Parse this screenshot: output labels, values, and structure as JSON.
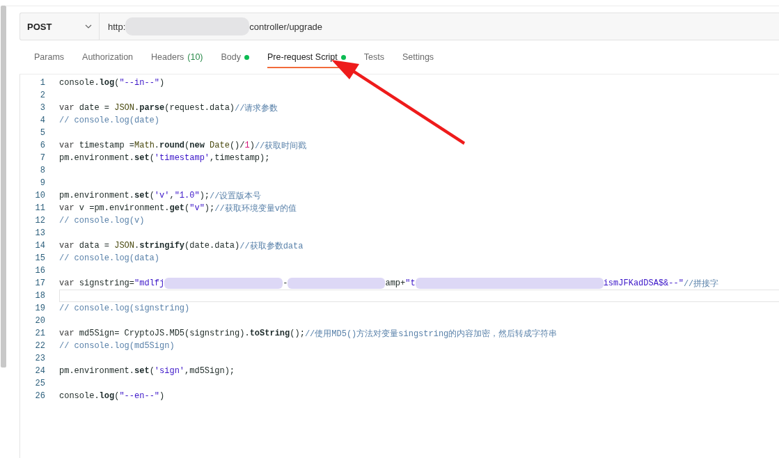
{
  "request": {
    "method": "POST",
    "url_start": "http:",
    "url_end": "controller/upgrade"
  },
  "tabs": [
    {
      "label": "Params",
      "selected": false,
      "dot": false
    },
    {
      "label": "Authorization",
      "selected": false,
      "dot": false
    },
    {
      "label": "Headers",
      "count": "(10)",
      "selected": false,
      "dot": false
    },
    {
      "label": "Body",
      "selected": false,
      "dot": true
    },
    {
      "label": "Pre-request Script",
      "selected": true,
      "dot": true
    },
    {
      "label": "Tests",
      "selected": false,
      "dot": false
    },
    {
      "label": "Settings",
      "selected": false,
      "dot": false
    }
  ],
  "editor": {
    "lines": [
      {
        "number": "1",
        "tokens": [
          {
            "kind": "plain",
            "text": "console."
          },
          {
            "kind": "fn",
            "text": "log"
          },
          {
            "kind": "plain",
            "text": "("
          },
          {
            "kind": "str",
            "text": "\"--in--\""
          },
          {
            "kind": "plain",
            "text": ")"
          }
        ]
      },
      {
        "number": "2"
      },
      {
        "number": "3",
        "tokens": [
          {
            "kind": "kw",
            "text": "var"
          },
          {
            "kind": "plain",
            "text": " date = "
          },
          {
            "kind": "obj",
            "text": "JSON"
          },
          {
            "kind": "plain",
            "text": "."
          },
          {
            "kind": "fn",
            "text": "parse"
          },
          {
            "kind": "plain",
            "text": "(request.data)"
          },
          {
            "kind": "cmt",
            "text": "//请求参数"
          }
        ]
      },
      {
        "number": "4",
        "tokens": [
          {
            "kind": "cmt",
            "text": "// console.log(date)"
          }
        ]
      },
      {
        "number": "5"
      },
      {
        "number": "6",
        "tokens": [
          {
            "kind": "kw",
            "text": "var"
          },
          {
            "kind": "plain",
            "text": " timestamp ="
          },
          {
            "kind": "obj",
            "text": "Math"
          },
          {
            "kind": "plain",
            "text": "."
          },
          {
            "kind": "fn",
            "text": "round"
          },
          {
            "kind": "plain",
            "text": "("
          },
          {
            "kind": "fn",
            "text": "new"
          },
          {
            "kind": "obj",
            "text": " Date"
          },
          {
            "kind": "plain",
            "text": "()/"
          },
          {
            "kind": "num",
            "text": "1"
          },
          {
            "kind": "plain",
            "text": ")"
          },
          {
            "kind": "cmt",
            "text": "//获取时间戳"
          }
        ]
      },
      {
        "number": "7",
        "tokens": [
          {
            "kind": "plain",
            "text": "pm.environment."
          },
          {
            "kind": "fn",
            "text": "set"
          },
          {
            "kind": "plain",
            "text": "("
          },
          {
            "kind": "str",
            "text": "'timestamp'"
          },
          {
            "kind": "plain",
            "text": ",timestamp);"
          }
        ]
      },
      {
        "number": "8"
      },
      {
        "number": "9"
      },
      {
        "number": "10",
        "tokens": [
          {
            "kind": "plain",
            "text": "pm.environment."
          },
          {
            "kind": "fn",
            "text": "set"
          },
          {
            "kind": "plain",
            "text": "("
          },
          {
            "kind": "str",
            "text": "'v'"
          },
          {
            "kind": "plain",
            "text": ","
          },
          {
            "kind": "str",
            "text": "\"1.0\""
          },
          {
            "kind": "plain",
            "text": ");"
          },
          {
            "kind": "cmt",
            "text": "//设置版本号"
          }
        ]
      },
      {
        "number": "11",
        "tokens": [
          {
            "kind": "kw",
            "text": "var"
          },
          {
            "kind": "plain",
            "text": " v =pm.environment."
          },
          {
            "kind": "fn",
            "text": "get"
          },
          {
            "kind": "plain",
            "text": "("
          },
          {
            "kind": "str",
            "text": "\"v\""
          },
          {
            "kind": "plain",
            "text": ");"
          },
          {
            "kind": "cmt",
            "text": "//获取环境变量v的值"
          }
        ]
      },
      {
        "number": "12",
        "tokens": [
          {
            "kind": "cmt",
            "text": "// console.log(v)"
          }
        ]
      },
      {
        "number": "13"
      },
      {
        "number": "14",
        "tokens": [
          {
            "kind": "kw",
            "text": "var"
          },
          {
            "kind": "plain",
            "text": " data = "
          },
          {
            "kind": "obj",
            "text": "JSON"
          },
          {
            "kind": "plain",
            "text": "."
          },
          {
            "kind": "fn",
            "text": "stringify"
          },
          {
            "kind": "plain",
            "text": "(date.data)"
          },
          {
            "kind": "cmt",
            "text": "//获取参数data"
          }
        ]
      },
      {
        "number": "15",
        "tokens": [
          {
            "kind": "cmt",
            "text": "// console.log(data)"
          }
        ]
      },
      {
        "number": "16"
      },
      {
        "number": "17",
        "tokens": [
          {
            "kind": "kw",
            "text": "var"
          },
          {
            "kind": "plain",
            "text": " signstring="
          },
          {
            "kind": "str",
            "text": "\"mdlfj"
          },
          {
            "kind": "blur"
          },
          {
            "kind": "plain",
            "text": "-"
          },
          {
            "kind": "blur"
          },
          {
            "kind": "plain",
            "text": "amp+"
          },
          {
            "kind": "str",
            "text": "\"t"
          },
          {
            "kind": "blur"
          },
          {
            "kind": "str",
            "text": "ismJFKadDSA$&--\""
          },
          {
            "kind": "cmt",
            "text": "//拼接字"
          }
        ]
      },
      {
        "number": "18",
        "current": true
      },
      {
        "number": "19",
        "tokens": [
          {
            "kind": "cmt",
            "text": "// console.log(signstring)"
          }
        ]
      },
      {
        "number": "20"
      },
      {
        "number": "21",
        "tokens": [
          {
            "kind": "kw",
            "text": "var"
          },
          {
            "kind": "plain",
            "text": " md5Sign= CryptoJS.MD5(signstring)."
          },
          {
            "kind": "fn",
            "text": "toString"
          },
          {
            "kind": "plain",
            "text": "();"
          },
          {
            "kind": "cmt",
            "text": "//使用MD5()方法对变量singstring的内容加密，然后转成字符串"
          }
        ]
      },
      {
        "number": "22",
        "tokens": [
          {
            "kind": "cmt",
            "text": "// console.log(md5Sign)"
          }
        ]
      },
      {
        "number": "23"
      },
      {
        "number": "24",
        "tokens": [
          {
            "kind": "plain",
            "text": "pm.environment."
          },
          {
            "kind": "fn",
            "text": "set"
          },
          {
            "kind": "plain",
            "text": "("
          },
          {
            "kind": "str",
            "text": "'sign'"
          },
          {
            "kind": "plain",
            "text": ",md5Sign);"
          }
        ]
      },
      {
        "number": "25"
      },
      {
        "number": "26",
        "tokens": [
          {
            "kind": "plain",
            "text": "console."
          },
          {
            "kind": "fn",
            "text": "log"
          },
          {
            "kind": "plain",
            "text": "("
          },
          {
            "kind": "str",
            "text": "\"--en--\""
          },
          {
            "kind": "plain",
            "text": ")"
          }
        ]
      }
    ]
  }
}
